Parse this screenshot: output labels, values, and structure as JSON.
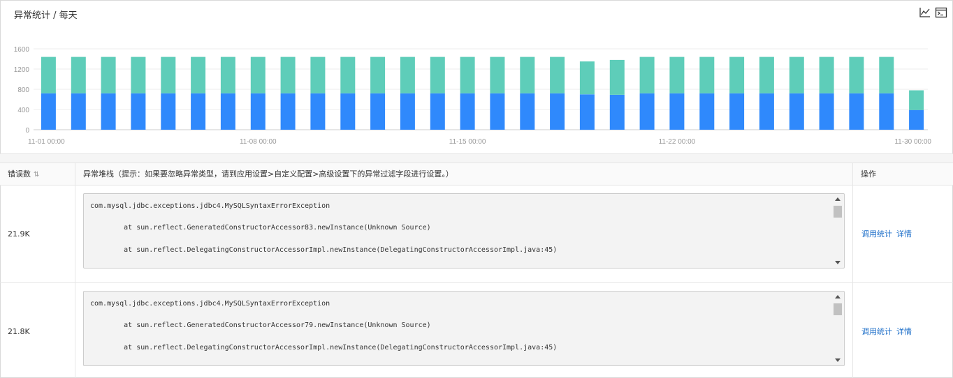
{
  "header": {
    "title": "异常统计 / 每天",
    "tools": [
      "line-chart-icon",
      "console-icon"
    ]
  },
  "colors": {
    "series_bottom": "#2f89fc",
    "series_top": "#5ecdb9",
    "grid": "#eeeeee",
    "axis_text": "#999999",
    "link": "#1e6fc9"
  },
  "chart_data": {
    "type": "bar",
    "stacked": true,
    "x_tick_labels": [
      "11-01 00:00",
      "11-08 00:00",
      "11-15 00:00",
      "11-22 00:00",
      "11-30 00:00"
    ],
    "x_tick_indices": [
      0,
      7,
      14,
      21,
      29
    ],
    "ylim": [
      0,
      1600
    ],
    "yticks": [
      0,
      400,
      800,
      1200,
      1600
    ],
    "grid": true,
    "series": [
      {
        "values": [
          720,
          720,
          720,
          720,
          720,
          720,
          720,
          720,
          720,
          720,
          720,
          720,
          720,
          720,
          720,
          720,
          720,
          720,
          700,
          690,
          720,
          720,
          720,
          720,
          720,
          720,
          720,
          720,
          720,
          390
        ]
      },
      {
        "values": [
          720,
          720,
          720,
          720,
          720,
          720,
          720,
          720,
          720,
          720,
          720,
          720,
          720,
          720,
          720,
          720,
          720,
          720,
          650,
          690,
          720,
          720,
          720,
          720,
          720,
          720,
          720,
          720,
          720,
          390
        ]
      }
    ]
  },
  "table": {
    "headers": {
      "count": "错误数",
      "stack": "异常堆栈（提示：如果要忽略异常类型，请到应用设置>自定义配置>高级设置下的异常过滤字段进行设置。）",
      "ops": "操作"
    },
    "rows": [
      {
        "count": "21.9K",
        "stack": "com.mysql.jdbc.exceptions.jdbc4.MySQLSyntaxErrorException\n\n        at sun.reflect.GeneratedConstructorAccessor83.newInstance(Unknown Source)\n\n        at sun.reflect.DelegatingConstructorAccessorImpl.newInstance(DelegatingConstructorAccessorImpl.java:45)",
        "op_call": "调用统计",
        "op_detail": "详情"
      },
      {
        "count": "21.8K",
        "stack": "com.mysql.jdbc.exceptions.jdbc4.MySQLSyntaxErrorException\n\n        at sun.reflect.GeneratedConstructorAccessor79.newInstance(Unknown Source)\n\n        at sun.reflect.DelegatingConstructorAccessorImpl.newInstance(DelegatingConstructorAccessorImpl.java:45)",
        "op_call": "调用统计",
        "op_detail": "详情"
      }
    ]
  }
}
